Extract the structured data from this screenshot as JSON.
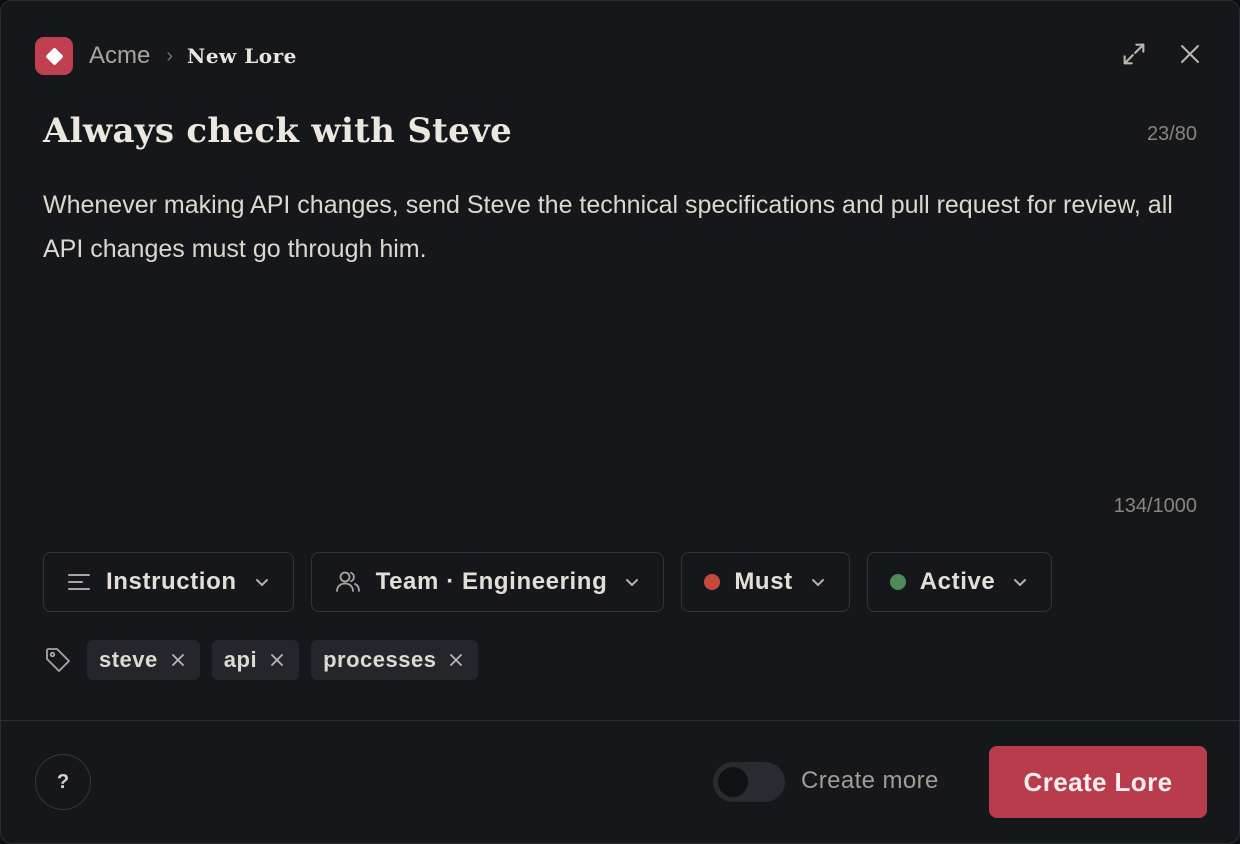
{
  "breadcrumb": {
    "org": "Acme",
    "page": "New Lore"
  },
  "title": {
    "text": "Always check with Steve",
    "count": "23/80"
  },
  "description": {
    "text": "Whenever making API changes, send Steve the technical specifications and pull request for review, all API changes must go through him.",
    "count": "134/1000"
  },
  "properties": {
    "type": {
      "label": "Instruction",
      "icon": "lines-icon"
    },
    "scope": {
      "label": "Team · Engineering",
      "icon": "users-icon"
    },
    "priority": {
      "label": "Must",
      "color": "#c7493b"
    },
    "status": {
      "label": "Active",
      "color": "#4f8a5a"
    }
  },
  "tags": [
    "steve",
    "api",
    "processes"
  ],
  "footer": {
    "help_label": "?",
    "toggle_label": "Create more",
    "toggle_on": false,
    "submit_label": "Create Lore"
  },
  "colors": {
    "accent": "#b83c4b",
    "logo": "#c0404f",
    "background": "#16171b"
  }
}
